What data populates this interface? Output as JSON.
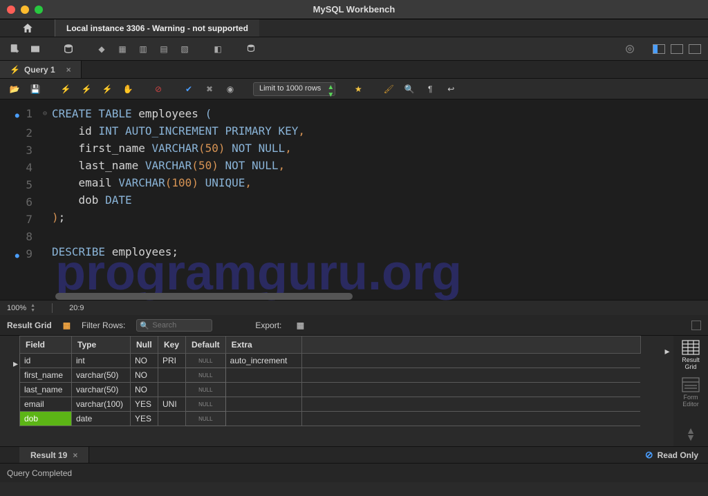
{
  "app_title": "MySQL Workbench",
  "connection_tab": "Local instance 3306 - Warning - not supported",
  "query_tab": "Query 1",
  "limit": "Limit to 1000 rows",
  "editor": {
    "lines": [
      {
        "n": 1,
        "dot": true,
        "fold": "⊖",
        "tokens": [
          [
            "k-blue",
            "CREATE TABLE"
          ],
          [
            "k-white",
            " employees "
          ],
          [
            "k-blue",
            "("
          ]
        ]
      },
      {
        "n": 2,
        "tokens": [
          [
            "k-white",
            "    id "
          ],
          [
            "k-blue",
            "INT AUTO_INCREMENT PRIMARY KEY"
          ],
          [
            "k-orange",
            ","
          ]
        ]
      },
      {
        "n": 3,
        "tokens": [
          [
            "k-white",
            "    first_name "
          ],
          [
            "k-blue",
            "VARCHAR"
          ],
          [
            "k-orange",
            "("
          ],
          [
            "k-num",
            "50"
          ],
          [
            "k-orange",
            ")"
          ],
          [
            "k-blue",
            " NOT NULL"
          ],
          [
            "k-orange",
            ","
          ]
        ]
      },
      {
        "n": 4,
        "tokens": [
          [
            "k-white",
            "    last_name "
          ],
          [
            "k-blue",
            "VARCHAR"
          ],
          [
            "k-orange",
            "("
          ],
          [
            "k-num",
            "50"
          ],
          [
            "k-orange",
            ")"
          ],
          [
            "k-blue",
            " NOT NULL"
          ],
          [
            "k-orange",
            ","
          ]
        ]
      },
      {
        "n": 5,
        "tokens": [
          [
            "k-white",
            "    email "
          ],
          [
            "k-blue",
            "VARCHAR"
          ],
          [
            "k-orange",
            "("
          ],
          [
            "k-num",
            "100"
          ],
          [
            "k-orange",
            ")"
          ],
          [
            "k-blue",
            " UNIQUE"
          ],
          [
            "k-orange",
            ","
          ]
        ]
      },
      {
        "n": 6,
        "tokens": [
          [
            "k-white",
            "    dob "
          ],
          [
            "k-blue",
            "DATE"
          ]
        ]
      },
      {
        "n": 7,
        "tokens": [
          [
            "k-orange",
            ")"
          ],
          [
            "k-white",
            ";"
          ]
        ]
      },
      {
        "n": 8,
        "tokens": [
          [
            "k-white",
            " "
          ]
        ]
      },
      {
        "n": 9,
        "dot": true,
        "tokens": [
          [
            "k-blue",
            "DESCRIBE"
          ],
          [
            "k-white",
            " employees;"
          ]
        ]
      }
    ]
  },
  "zoom": "100%",
  "cursor_pos": "20:9",
  "watermark": "programguru.org",
  "result": {
    "header_label": "Result Grid",
    "filter_label": "Filter Rows:",
    "filter_placeholder": "Search",
    "export_label": "Export:",
    "columns": [
      "Field",
      "Type",
      "Null",
      "Key",
      "Default",
      "Extra"
    ],
    "rows": [
      {
        "cells": [
          "id",
          "int",
          "NO",
          "PRI",
          "NULL",
          "auto_increment"
        ],
        "null_cols": [
          4
        ]
      },
      {
        "cells": [
          "first_name",
          "varchar(50)",
          "NO",
          "",
          "NULL",
          ""
        ],
        "null_cols": [
          4
        ]
      },
      {
        "cells": [
          "last_name",
          "varchar(50)",
          "NO",
          "",
          "NULL",
          ""
        ],
        "null_cols": [
          4
        ]
      },
      {
        "cells": [
          "email",
          "varchar(100)",
          "YES",
          "UNI",
          "NULL",
          ""
        ],
        "null_cols": [
          4
        ]
      },
      {
        "cells": [
          "dob",
          "date",
          "YES",
          "",
          "NULL",
          ""
        ],
        "null_cols": [
          4
        ],
        "hl": true
      }
    ],
    "tab_label": "Result 19",
    "readonly_label": "Read Only",
    "side": [
      {
        "icon": "grid",
        "label": "Result\nGrid",
        "active": true
      },
      {
        "icon": "form",
        "label": "Form\nEditor"
      }
    ]
  },
  "status": "Query Completed"
}
